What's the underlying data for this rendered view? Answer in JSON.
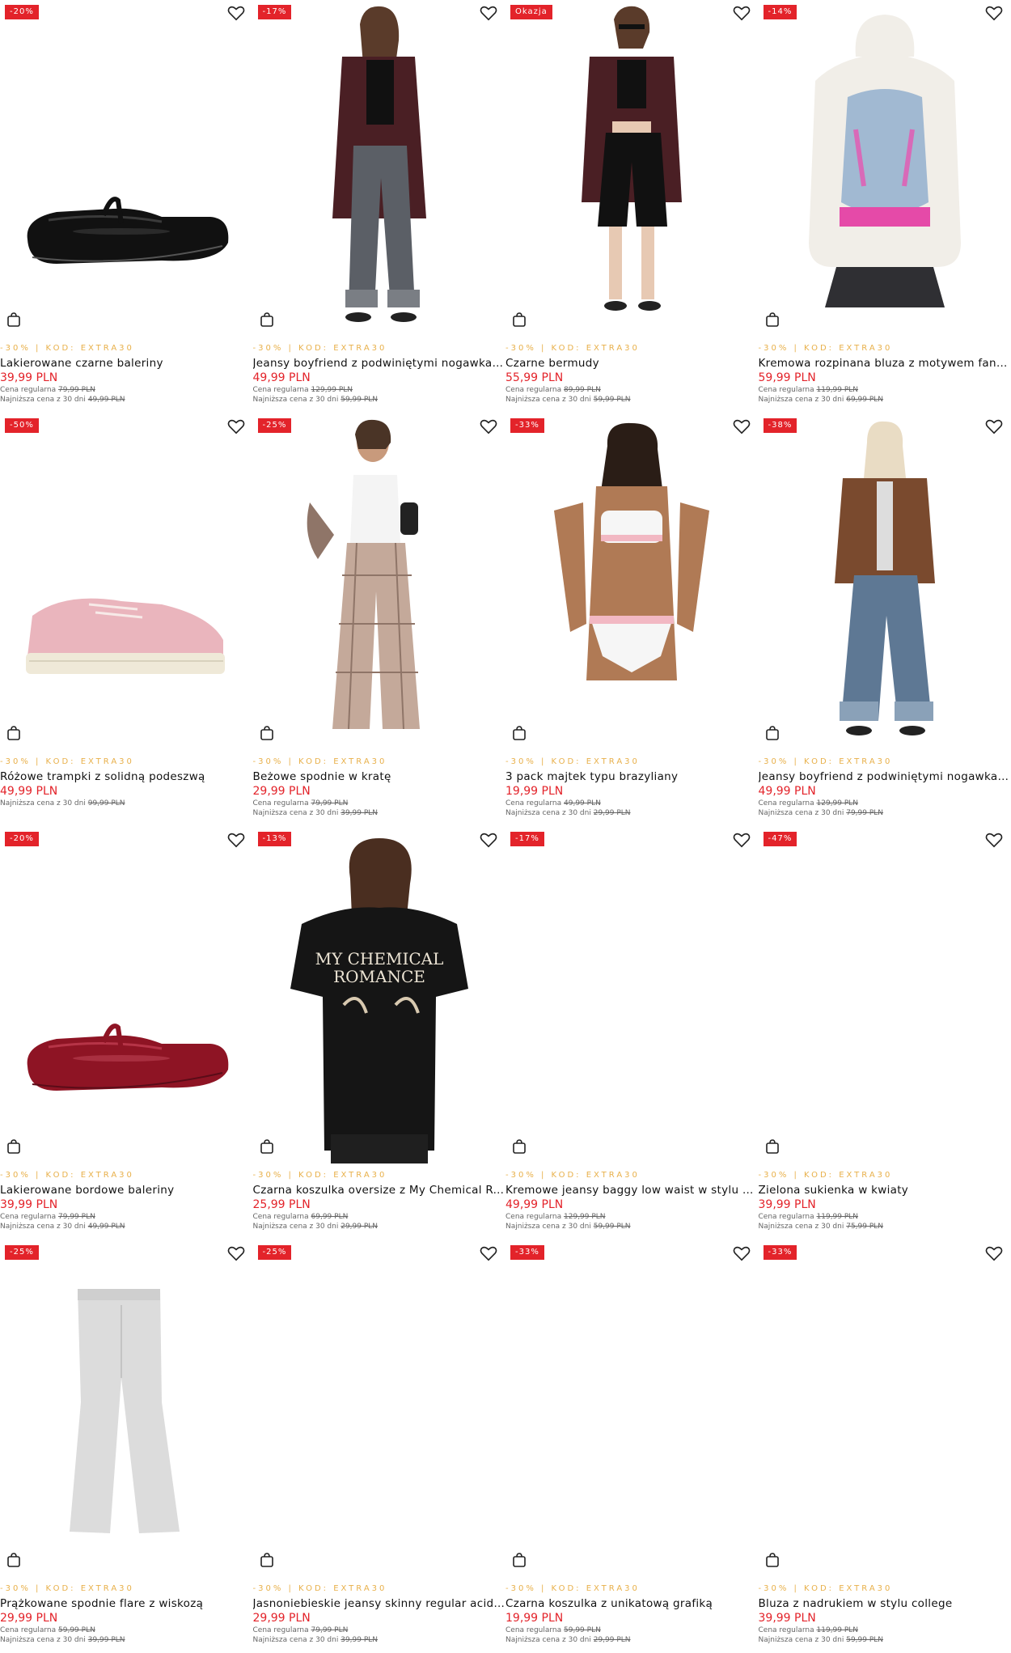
{
  "colors": {
    "badge": "#e3232a",
    "price": "#e3232a",
    "promo": "#e8b04a"
  },
  "products": [
    {
      "badge": "-20%",
      "promo": "-30% | KOD: EXTRA30",
      "name": "Lakierowane czarne baleriny",
      "price": "39,99 PLN",
      "regular_label": "Cena regularna",
      "regular": "79,99 PLN",
      "lowest_label": "Najniższa cena z 30 dni",
      "lowest": "49,99 PLN",
      "image": "black-ballerina-shoe"
    },
    {
      "badge": "-17%",
      "promo": "-30% | KOD: EXTRA30",
      "name": "Jeansy boyfriend z podwiniętymi nogawkami",
      "price": "49,99 PLN",
      "regular_label": "Cena regularna",
      "regular": "129,99 PLN",
      "lowest_label": "Najniższa cena z 30 dni",
      "lowest": "59,99 PLN",
      "image": "model-boyfriend-jeans"
    },
    {
      "badge": "Okazja",
      "promo": "-30% | KOD: EXTRA30",
      "name": "Czarne bermudy",
      "price": "55,99 PLN",
      "regular_label": "Cena regularna",
      "regular": "89,99 PLN",
      "lowest_label": "Najniższa cena z 30 dni",
      "lowest": "59,99 PLN",
      "image": "model-black-bermudas"
    },
    {
      "badge": "-14%",
      "promo": "-30% | KOD: EXTRA30",
      "name": "Kremowa rozpinana bluza z motywem fantasy",
      "price": "59,99 PLN",
      "regular_label": "Cena regularna",
      "regular": "119,99 PLN",
      "lowest_label": "Najniższa cena z 30 dni",
      "lowest": "69,99 PLN",
      "image": "cream-hoodie-back"
    },
    {
      "badge": "-50%",
      "promo": "-30% | KOD: EXTRA30",
      "name": "Różowe trampki z solidną podeszwą",
      "price": "49,99 PLN",
      "regular_label": "",
      "regular": "",
      "lowest_label": "Najniższa cena z 30 dni",
      "lowest": "99,99 PLN",
      "image": "pink-sneaker"
    },
    {
      "badge": "-25%",
      "promo": "-30% | KOD: EXTRA30",
      "name": "Beżowe spodnie w kratę",
      "price": "29,99 PLN",
      "regular_label": "Cena regularna",
      "regular": "79,99 PLN",
      "lowest_label": "Najniższa cena z 30 dni",
      "lowest": "39,99 PLN",
      "image": "model-plaid-trousers"
    },
    {
      "badge": "-33%",
      "promo": "-30% | KOD: EXTRA30",
      "name": "3 pack majtek typu brazyliany",
      "price": "19,99 PLN",
      "regular_label": "Cena regularna",
      "regular": "49,99 PLN",
      "lowest_label": "Najniższa cena z 30 dni",
      "lowest": "29,99 PLN",
      "image": "model-underwear"
    },
    {
      "badge": "-38%",
      "promo": "-30% | KOD: EXTRA30",
      "name": "Jeansy boyfriend z podwiniętymi nogawkami",
      "price": "49,99 PLN",
      "regular_label": "Cena regularna",
      "regular": "129,99 PLN",
      "lowest_label": "Najniższa cena z 30 dni",
      "lowest": "79,99 PLN",
      "image": "model-brown-jacket-jeans"
    },
    {
      "badge": "-20%",
      "promo": "-30% | KOD: EXTRA30",
      "name": "Lakierowane bordowe baleriny",
      "price": "39,99 PLN",
      "regular_label": "Cena regularna",
      "regular": "79,99 PLN",
      "lowest_label": "Najniższa cena z 30 dni",
      "lowest": "49,99 PLN",
      "image": "burgundy-ballerina-shoe"
    },
    {
      "badge": "-13%",
      "promo": "-30% | KOD: EXTRA30",
      "name": "Czarna koszulka oversize z My Chemical Romance",
      "price": "25,99 PLN",
      "regular_label": "Cena regularna",
      "regular": "69,99 PLN",
      "lowest_label": "Najniższa cena z 30 dni",
      "lowest": "29,99 PLN",
      "image": "model-black-tshirt",
      "print": "MY CHEMICAL ROMANCE"
    },
    {
      "badge": "-17%",
      "promo": "-30% | KOD: EXTRA30",
      "name": "Kremowe jeansy baggy low waist w stylu vintage",
      "price": "49,99 PLN",
      "regular_label": "Cena regularna",
      "regular": "129,99 PLN",
      "lowest_label": "Najniższa cena z 30 dni",
      "lowest": "59,99 PLN",
      "image": ""
    },
    {
      "badge": "-47%",
      "promo": "-30% | KOD: EXTRA30",
      "name": "Zielona sukienka w kwiaty",
      "price": "39,99 PLN",
      "regular_label": "Cena regularna",
      "regular": "119,99 PLN",
      "lowest_label": "Najniższa cena z 30 dni",
      "lowest": "75,99 PLN",
      "image": ""
    },
    {
      "badge": "-25%",
      "promo": "-30% | KOD: EXTRA30",
      "name": "Prążkowane spodnie flare z wiskozą",
      "price": "29,99 PLN",
      "regular_label": "Cena regularna",
      "regular": "59,99 PLN",
      "lowest_label": "Najniższa cena z 30 dni",
      "lowest": "39,99 PLN",
      "image": "grey-flare-trousers"
    },
    {
      "badge": "-25%",
      "promo": "-30% | KOD: EXTRA30",
      "name": "Jasnoniebieskie jeansy skinny regular acid wash",
      "price": "29,99 PLN",
      "regular_label": "Cena regularna",
      "regular": "79,99 PLN",
      "lowest_label": "Najniższa cena z 30 dni",
      "lowest": "39,99 PLN",
      "image": ""
    },
    {
      "badge": "-33%",
      "promo": "-30% | KOD: EXTRA30",
      "name": "Czarna koszulka z unikatową grafiką",
      "price": "19,99 PLN",
      "regular_label": "Cena regularna",
      "regular": "59,99 PLN",
      "lowest_label": "Najniższa cena z 30 dni",
      "lowest": "29,99 PLN",
      "image": ""
    },
    {
      "badge": "-33%",
      "promo": "-30% | KOD: EXTRA30",
      "name": "Bluza z nadrukiem w stylu college",
      "price": "39,99 PLN",
      "regular_label": "Cena regularna",
      "regular": "119,99 PLN",
      "lowest_label": "Najniższa cena z 30 dni",
      "lowest": "59,99 PLN",
      "image": ""
    }
  ]
}
